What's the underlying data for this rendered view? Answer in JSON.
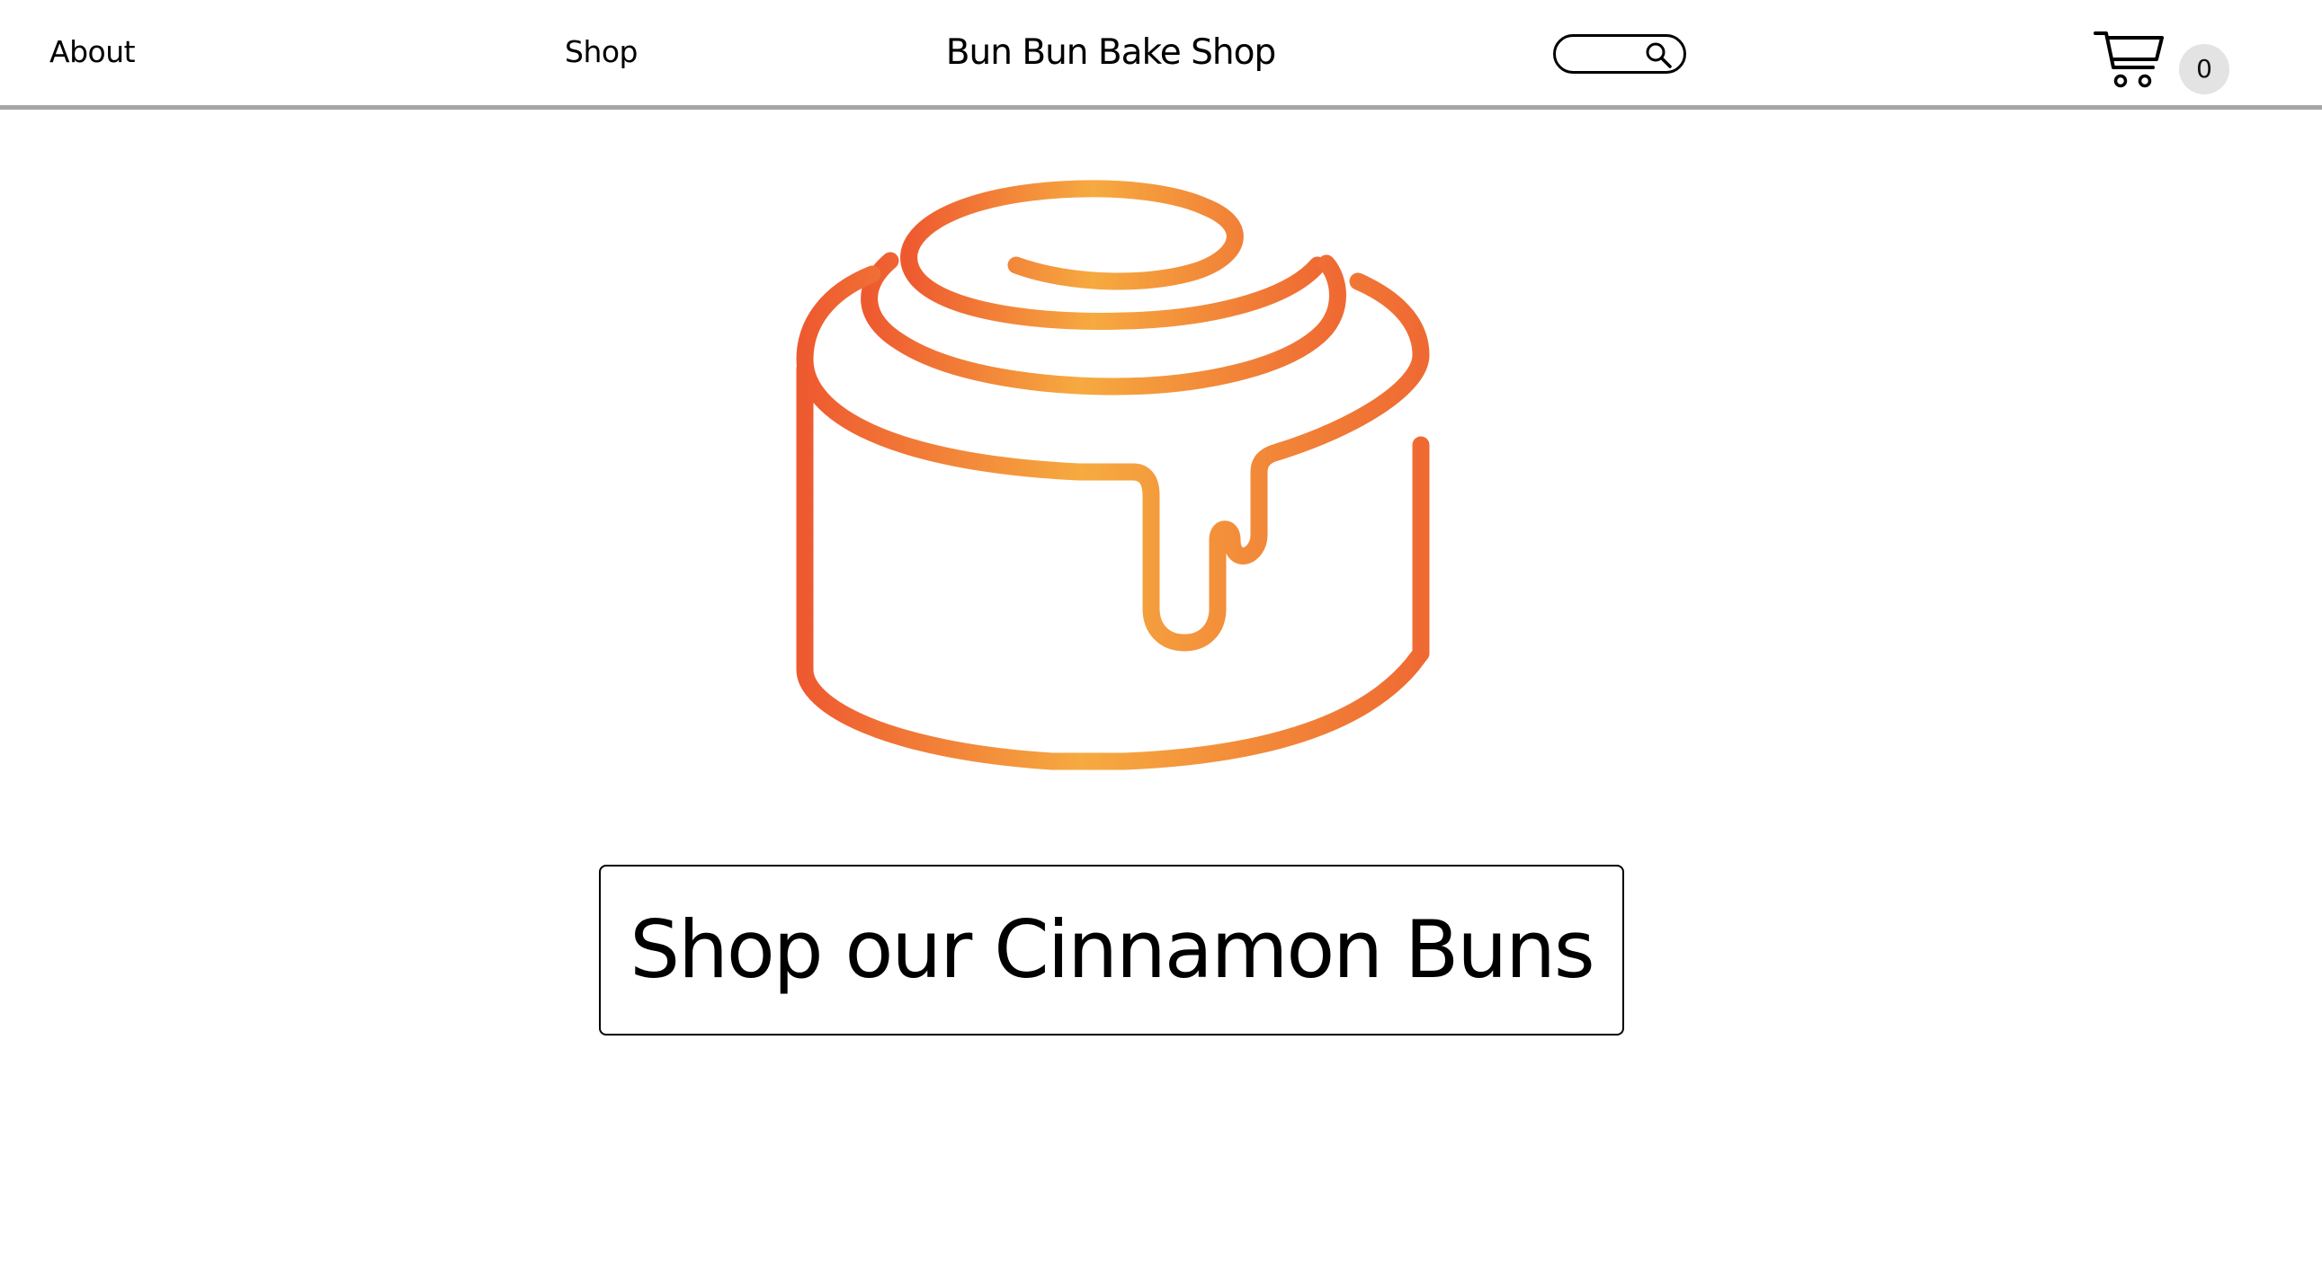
{
  "nav": {
    "about_label": "About",
    "shop_label": "Shop"
  },
  "brand": {
    "title": "Bun Bun Bake Shop"
  },
  "search": {
    "value": "",
    "icon": "search-icon"
  },
  "cart": {
    "icon": "cart-icon",
    "count": "0"
  },
  "hero": {
    "illustration": "cinnamon-bun-icon",
    "cta_label": "Shop our Cinnamon Buns"
  },
  "colors": {
    "accent_orange": "#f0602e",
    "accent_amber": "#f6aa40",
    "header_border": "#a6a6a6",
    "cart_badge_bg": "#e3e3e3"
  }
}
